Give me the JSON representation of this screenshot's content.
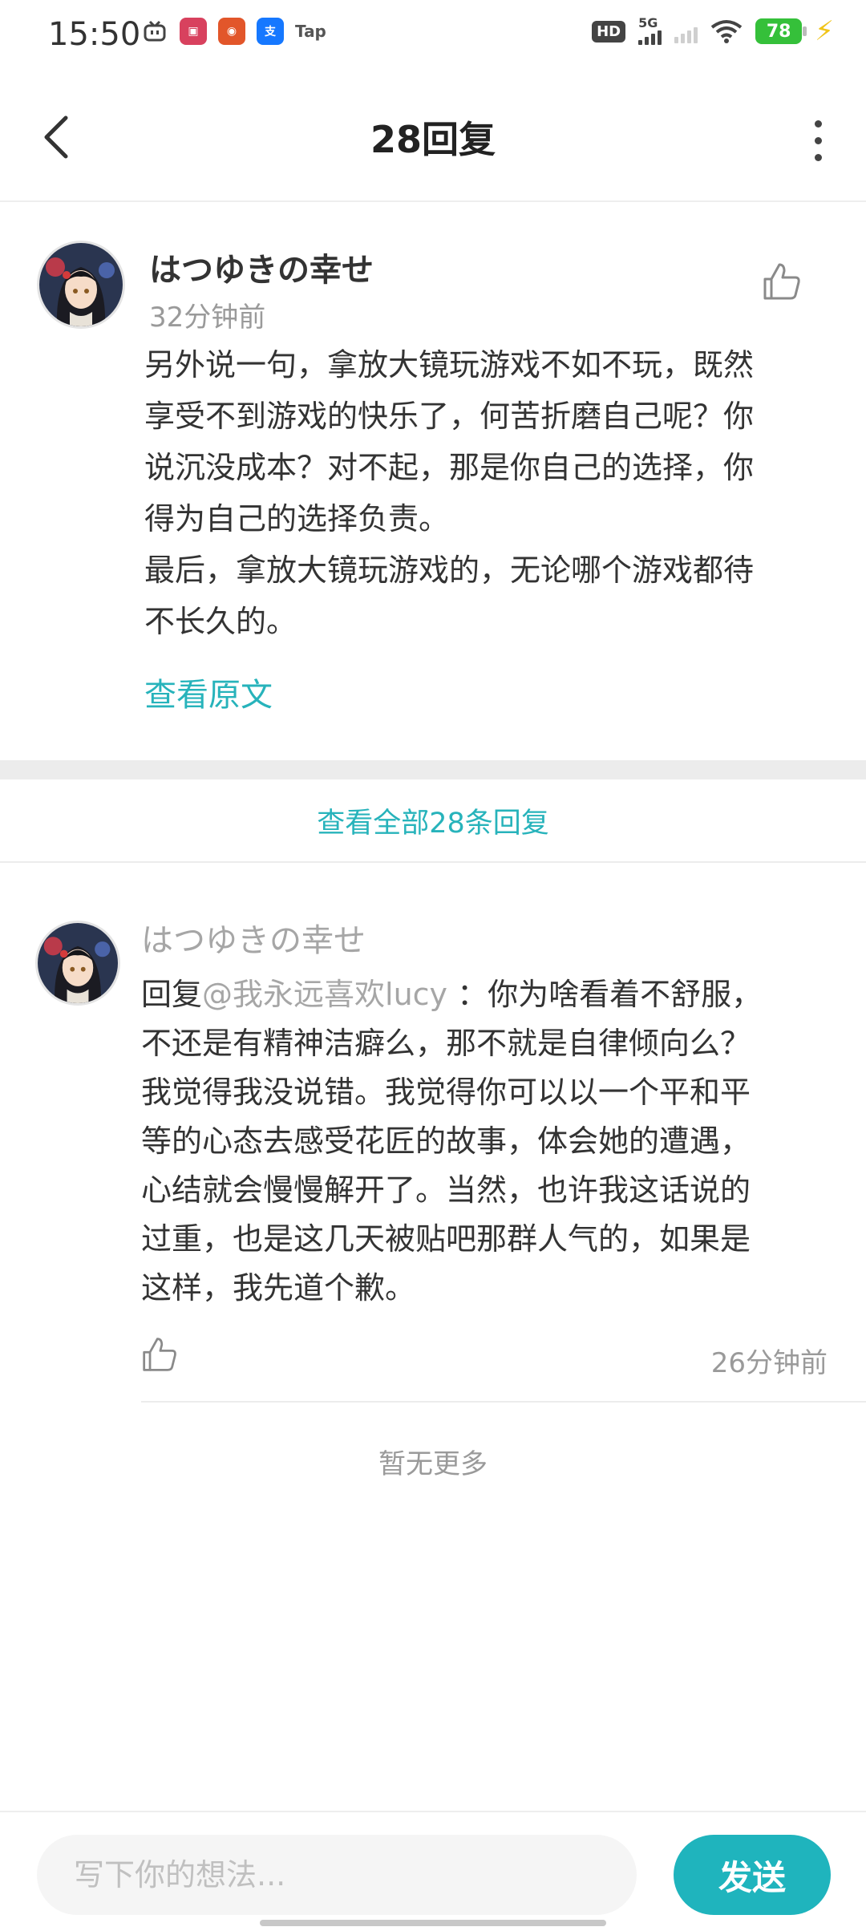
{
  "status_bar": {
    "time": "15:50",
    "app_icons": [
      "tv-icon",
      "app-badge-icon",
      "game-icon",
      "alipay-icon",
      "taptap-icon"
    ],
    "tap_label": "Tap",
    "hd_label": "HD",
    "network": "5G",
    "battery": "78",
    "icons": [
      "wifi-icon",
      "signal-icon",
      "battery-icon",
      "charging-icon"
    ]
  },
  "header": {
    "title": "28回复",
    "icons": [
      "back-icon",
      "more-icon"
    ]
  },
  "original_comment": {
    "username": "はつゆきの幸せ",
    "time": "32分钟前",
    "lines": [
      "另外说一句，拿放大镜玩游戏不如不玩，既然",
      "享受不到游戏的快乐了，何苦折磨自己呢？你",
      "说沉没成本？对不起，那是你自己的选择，你",
      "得为自己的选择负责。",
      "最后，拿放大镜玩游戏的，无论哪个游戏都待",
      "不长久的。"
    ],
    "view_original": "查看原文",
    "icons": [
      "thumbs-up-icon"
    ]
  },
  "view_all": "查看全部28条回复",
  "reply": {
    "username": "はつゆきの幸せ",
    "prefix": "回复",
    "mention": "@我永远喜欢lucy",
    "first_line_rest": " ：你为啥看着不舒服，",
    "lines": [
      "不还是有精神洁癖么，那不就是自律倾向么？",
      "我觉得我没说错。我觉得你可以以一个平和平",
      "等的心态去感受花匠的故事，体会她的遭遇，",
      "心结就会慢慢解开了。当然，也许我这话说的",
      "过重，也是这几天被贴吧那群人气的，如果是",
      "这样，我先道个歉。"
    ],
    "time": "26分钟前",
    "icons": [
      "thumbs-up-icon"
    ]
  },
  "no_more": "暂无更多",
  "compose": {
    "placeholder": "写下你的想法...",
    "send_label": "发送"
  },
  "colors": {
    "accent": "#1fb4bd",
    "link": "#27b3bb",
    "muted": "#9a9a9a"
  }
}
